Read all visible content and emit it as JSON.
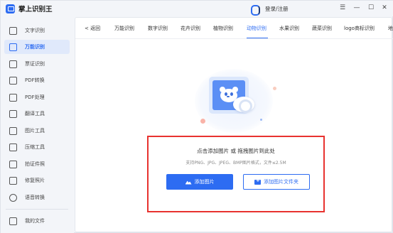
{
  "app": {
    "title": "掌上识别王"
  },
  "header": {
    "login_label": "登录/注册",
    "menu_glyph": "☰",
    "minimize_glyph": "—",
    "maximize_glyph": "☐",
    "close_glyph": "✕"
  },
  "sidebar": {
    "items": [
      {
        "label": "文字识别",
        "icon": "text-recognition-icon"
      },
      {
        "label": "万能识别",
        "icon": "universal-recognition-icon"
      },
      {
        "label": "票证识别",
        "icon": "ticket-recognition-icon"
      },
      {
        "label": "PDF转换",
        "icon": "pdf-convert-icon"
      },
      {
        "label": "PDF处理",
        "icon": "pdf-process-icon"
      },
      {
        "label": "翻译工具",
        "icon": "translate-icon"
      },
      {
        "label": "图片工具",
        "icon": "image-tools-icon"
      },
      {
        "label": "压缩工具",
        "icon": "compress-icon"
      },
      {
        "label": "拍证件照",
        "icon": "id-photo-icon"
      },
      {
        "label": "修复照片",
        "icon": "photo-repair-icon"
      },
      {
        "label": "语音转换",
        "icon": "voice-convert-icon"
      }
    ],
    "my_files": {
      "label": "我的文件",
      "icon": "my-files-icon"
    },
    "active_index": 1
  },
  "tabs": {
    "back_label": "< 返回",
    "items": [
      "万能识别",
      "数字识别",
      "花卉识别",
      "植物识别",
      "动物识别",
      "水果识别",
      "蔬菜识别",
      "logo商标识别",
      "地"
    ],
    "active_index": 4
  },
  "dropzone": {
    "title": "点击添加图片 或 拖拽图片到此处",
    "subtitle": "支持PNG、JPG、JPEG、BMP图片格式，文件≤2.5M",
    "add_image_label": "添加图片",
    "add_folder_label": "添加图片文件夹"
  },
  "colors": {
    "accent": "#2d6cf2",
    "highlight_border": "#e8322f"
  }
}
